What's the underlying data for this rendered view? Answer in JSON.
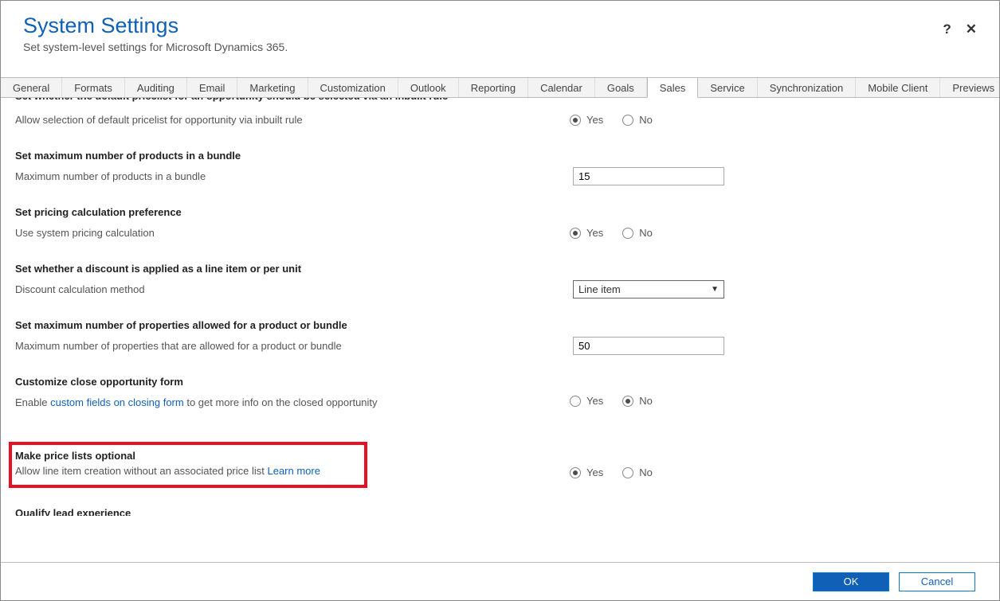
{
  "header": {
    "title": "System Settings",
    "subtitle": "Set system-level settings for Microsoft Dynamics 365."
  },
  "tabs": [
    "General",
    "Formats",
    "Auditing",
    "Email",
    "Marketing",
    "Customization",
    "Outlook",
    "Reporting",
    "Calendar",
    "Goals",
    "Sales",
    "Service",
    "Synchronization",
    "Mobile Client",
    "Previews"
  ],
  "activeTab": "Sales",
  "labels": {
    "yes": "Yes",
    "no": "No"
  },
  "sections": {
    "cutoff": {
      "head": "Set whether the default pricelist for an opportunity should be selected via an inbuilt rule",
      "row": "Allow selection of default pricelist for opportunity via inbuilt rule",
      "value": "yes"
    },
    "bundleMax": {
      "head": "Set maximum number of products in a bundle",
      "row": "Maximum number of products in a bundle",
      "value": "15"
    },
    "pricing": {
      "head": "Set pricing calculation preference",
      "row": "Use system pricing calculation",
      "value": "yes"
    },
    "discount": {
      "head": "Set whether a discount is applied as a line item or per unit",
      "row": "Discount calculation method",
      "value": "Line item"
    },
    "propsMax": {
      "head": "Set maximum number of properties allowed for a product or bundle",
      "row": "Maximum number of properties that are allowed for a product or bundle",
      "value": "50"
    },
    "closeOpp": {
      "head": "Customize close opportunity form",
      "rowPrefix": "Enable ",
      "rowLink": "custom fields on closing form",
      "rowSuffix": " to get more info on the closed opportunity",
      "value": "no"
    },
    "priceList": {
      "head": "Make price lists optional",
      "rowPrefix": "Allow line item creation without an associated price list ",
      "rowLink": "Learn more",
      "value": "yes"
    },
    "qualify": {
      "head": "Qualify lead experience"
    }
  },
  "footer": {
    "ok": "OK",
    "cancel": "Cancel"
  }
}
